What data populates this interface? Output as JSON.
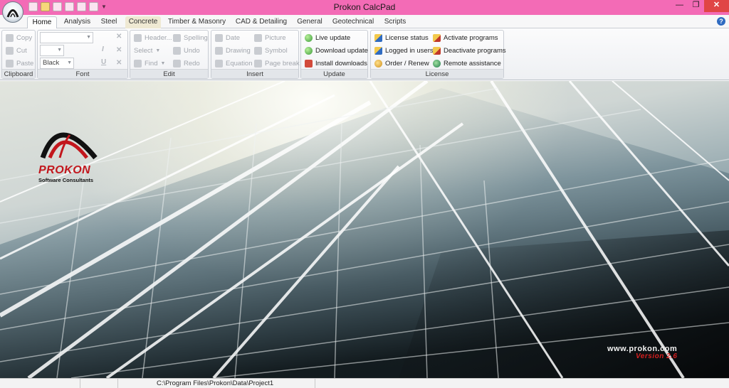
{
  "titlebar": {
    "title": "Prokon CalcPad",
    "minimize": "—",
    "restore": "❐",
    "close": "✕"
  },
  "tabs": [
    {
      "label": "Home"
    },
    {
      "label": "Analysis"
    },
    {
      "label": "Steel"
    },
    {
      "label": "Concrete"
    },
    {
      "label": "Timber & Masonry"
    },
    {
      "label": "CAD & Detailing"
    },
    {
      "label": "General"
    },
    {
      "label": "Geotechnical"
    },
    {
      "label": "Scripts"
    }
  ],
  "help_label": "?",
  "ribbon": {
    "clipboard": {
      "label": "Clipboard",
      "copy": "Copy",
      "cut": "Cut",
      "paste": "Paste"
    },
    "font": {
      "label": "Font",
      "family_value": "",
      "size_value": "",
      "color_value": "Black",
      "italic": "I",
      "underline": "U"
    },
    "edit": {
      "label": "Edit",
      "header": "Header...",
      "spelling": "Spelling",
      "select": "Select",
      "undo": "Undo",
      "find": "Find",
      "redo": "Redo"
    },
    "insert": {
      "label": "Insert",
      "date": "Date",
      "picture": "Picture",
      "drawing": "Drawing",
      "symbol": "Symbol",
      "equation": "Equation",
      "page_break": "Page break"
    },
    "update": {
      "label": "Update",
      "live_update": "Live update",
      "download_update": "Download update",
      "install_downloads": "Install downloads"
    },
    "license": {
      "label": "License",
      "license_status": "License status",
      "logged_in_users": "Logged in users",
      "order_renew": "Order / Renew",
      "activate_programs": "Activate programs",
      "deactivate_programs": "Deactivate programs",
      "remote_assistance": "Remote assistance"
    }
  },
  "splash": {
    "brand": "PROKON",
    "brand_sub": "Software Consultants",
    "website": "www.prokon.com",
    "version": "Version 2.6"
  },
  "statusbar": {
    "path": "C:\\Program Files\\Prokon\\Data\\Project1"
  },
  "colors": {
    "titlebar": "#f36bb6",
    "brand_red": "#c2171d"
  }
}
